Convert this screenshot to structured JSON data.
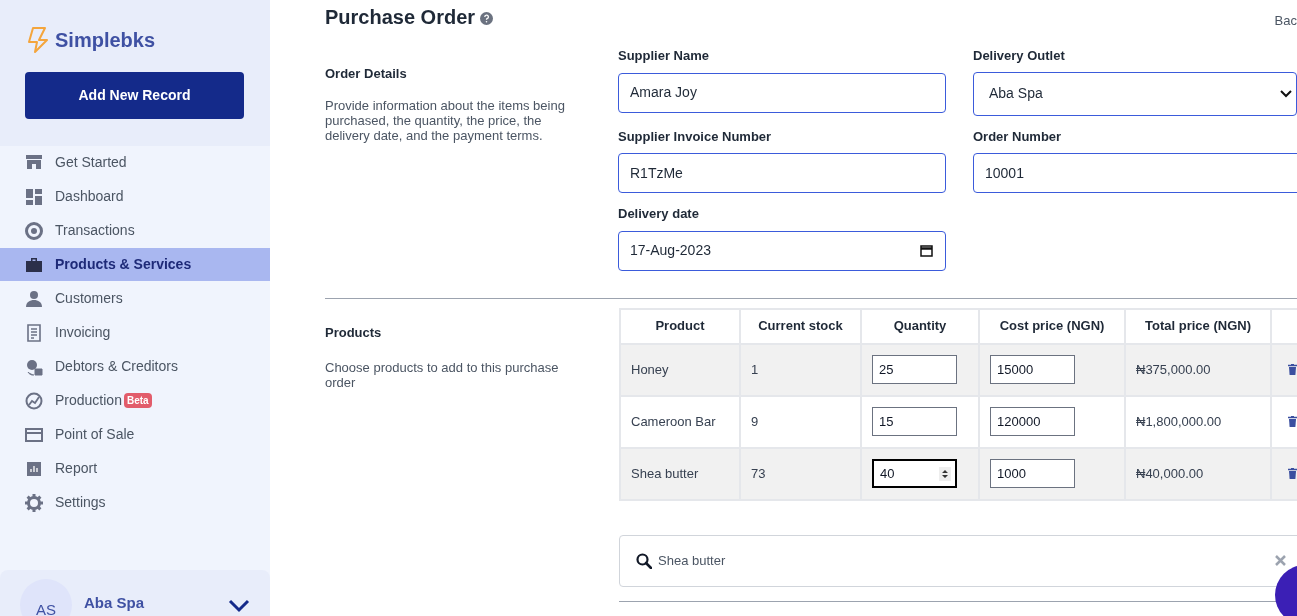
{
  "brand": "Simplebks",
  "add_button": "Add New Record",
  "nav": [
    {
      "label": "Get Started",
      "selected": false
    },
    {
      "label": "Dashboard",
      "selected": false
    },
    {
      "label": "Transactions",
      "selected": false
    },
    {
      "label": "Products & Services",
      "selected": true
    },
    {
      "label": "Customers",
      "selected": false
    },
    {
      "label": "Invoicing",
      "selected": false
    },
    {
      "label": "Debtors & Creditors",
      "selected": false
    },
    {
      "label": "Production",
      "badge": "Beta",
      "selected": false
    },
    {
      "label": "Point of Sale",
      "selected": false
    },
    {
      "label": "Report",
      "selected": false
    },
    {
      "label": "Settings",
      "selected": false
    }
  ],
  "profile": {
    "initials": "AS",
    "name": "Aba Spa"
  },
  "title": "Purchase Order",
  "back": "Bac",
  "order_details": {
    "heading": "Order Details",
    "description": "Provide information about the items being purchased, the quantity, the price, the delivery date, and the payment terms."
  },
  "fields": [
    {
      "label": "Supplier Name",
      "value": "Amara Joy",
      "kind": "text"
    },
    {
      "label": "Delivery Outlet",
      "value": "Aba Spa",
      "kind": "select"
    },
    {
      "label": "Supplier Invoice Number",
      "value": "R1TzMe",
      "kind": "text"
    },
    {
      "label": "Order Number",
      "value": "10001",
      "kind": "text"
    },
    {
      "label": "Delivery date",
      "value": "17-Aug-2023",
      "kind": "date"
    }
  ],
  "products": {
    "heading": "Products",
    "description": "Choose products to add to this purchase order"
  },
  "table": {
    "columns": [
      "Product",
      "Current stock",
      "Quantity",
      "Cost price (NGN)",
      "Total price (NGN)"
    ],
    "rows": [
      {
        "product": "Honey",
        "stock": "1",
        "quantity": "25",
        "cost": "15000",
        "total": "₦375,000.00",
        "focused": false
      },
      {
        "product": "Cameroon Bar",
        "stock": "9",
        "quantity": "15",
        "cost": "120000",
        "total": "₦1,800,000.00",
        "focused": false
      },
      {
        "product": "Shea butter",
        "stock": "73",
        "quantity": "40",
        "cost": "1000",
        "total": "₦40,000.00",
        "focused": true
      }
    ]
  },
  "search": {
    "value": "Shea butter"
  }
}
